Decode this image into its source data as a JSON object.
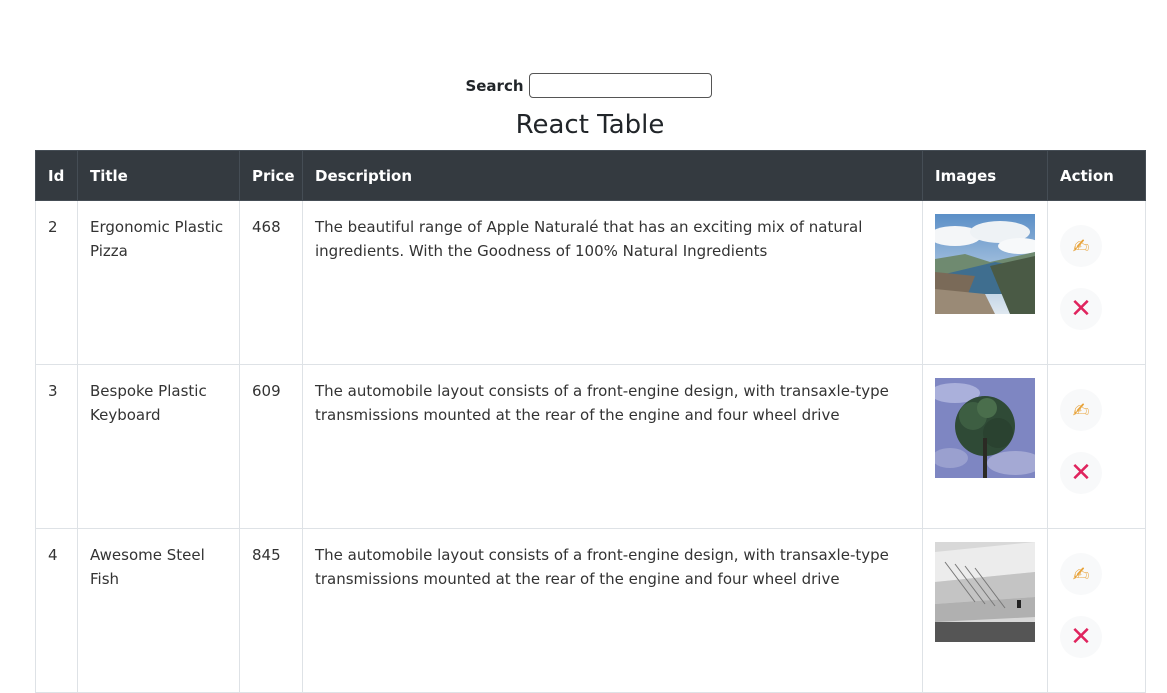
{
  "search": {
    "label": "Search",
    "value": "",
    "placeholder": ""
  },
  "title": "React Table",
  "columns": [
    "Id",
    "Title",
    "Price",
    "Description",
    "Images",
    "Action"
  ],
  "rows": [
    {
      "id": "2",
      "title": "Ergonomic Plastic Pizza",
      "price": "468",
      "description": "The beautiful range of Apple Naturalé that has an exciting mix of natural ingredients. With the Goodness of 100% Natural Ingredients",
      "image": "fjord-landscape-photo"
    },
    {
      "id": "3",
      "title": "Bespoke Plastic Keyboard",
      "price": "609",
      "description": "The automobile layout consists of a front-engine design, with transaxle-type transmissions mounted at the rear of the engine and four wheel drive",
      "image": "tree-reflection-photo"
    },
    {
      "id": "4",
      "title": "Awesome Steel Fish",
      "price": "845",
      "description": "The automobile layout consists of a front-engine design, with transaxle-type transmissions mounted at the rear of the engine and four wheel drive",
      "image": "stone-steps-photo"
    }
  ],
  "actions": {
    "edit_icon": "pencil-hand-icon",
    "edit_glyph": "✍",
    "delete_icon": "close-x-icon",
    "delete_glyph": "✕"
  },
  "colors": {
    "header_bg": "#343a40",
    "header_text": "#ffffff",
    "delete": "#e0245e",
    "edit": "#e8a33a"
  }
}
